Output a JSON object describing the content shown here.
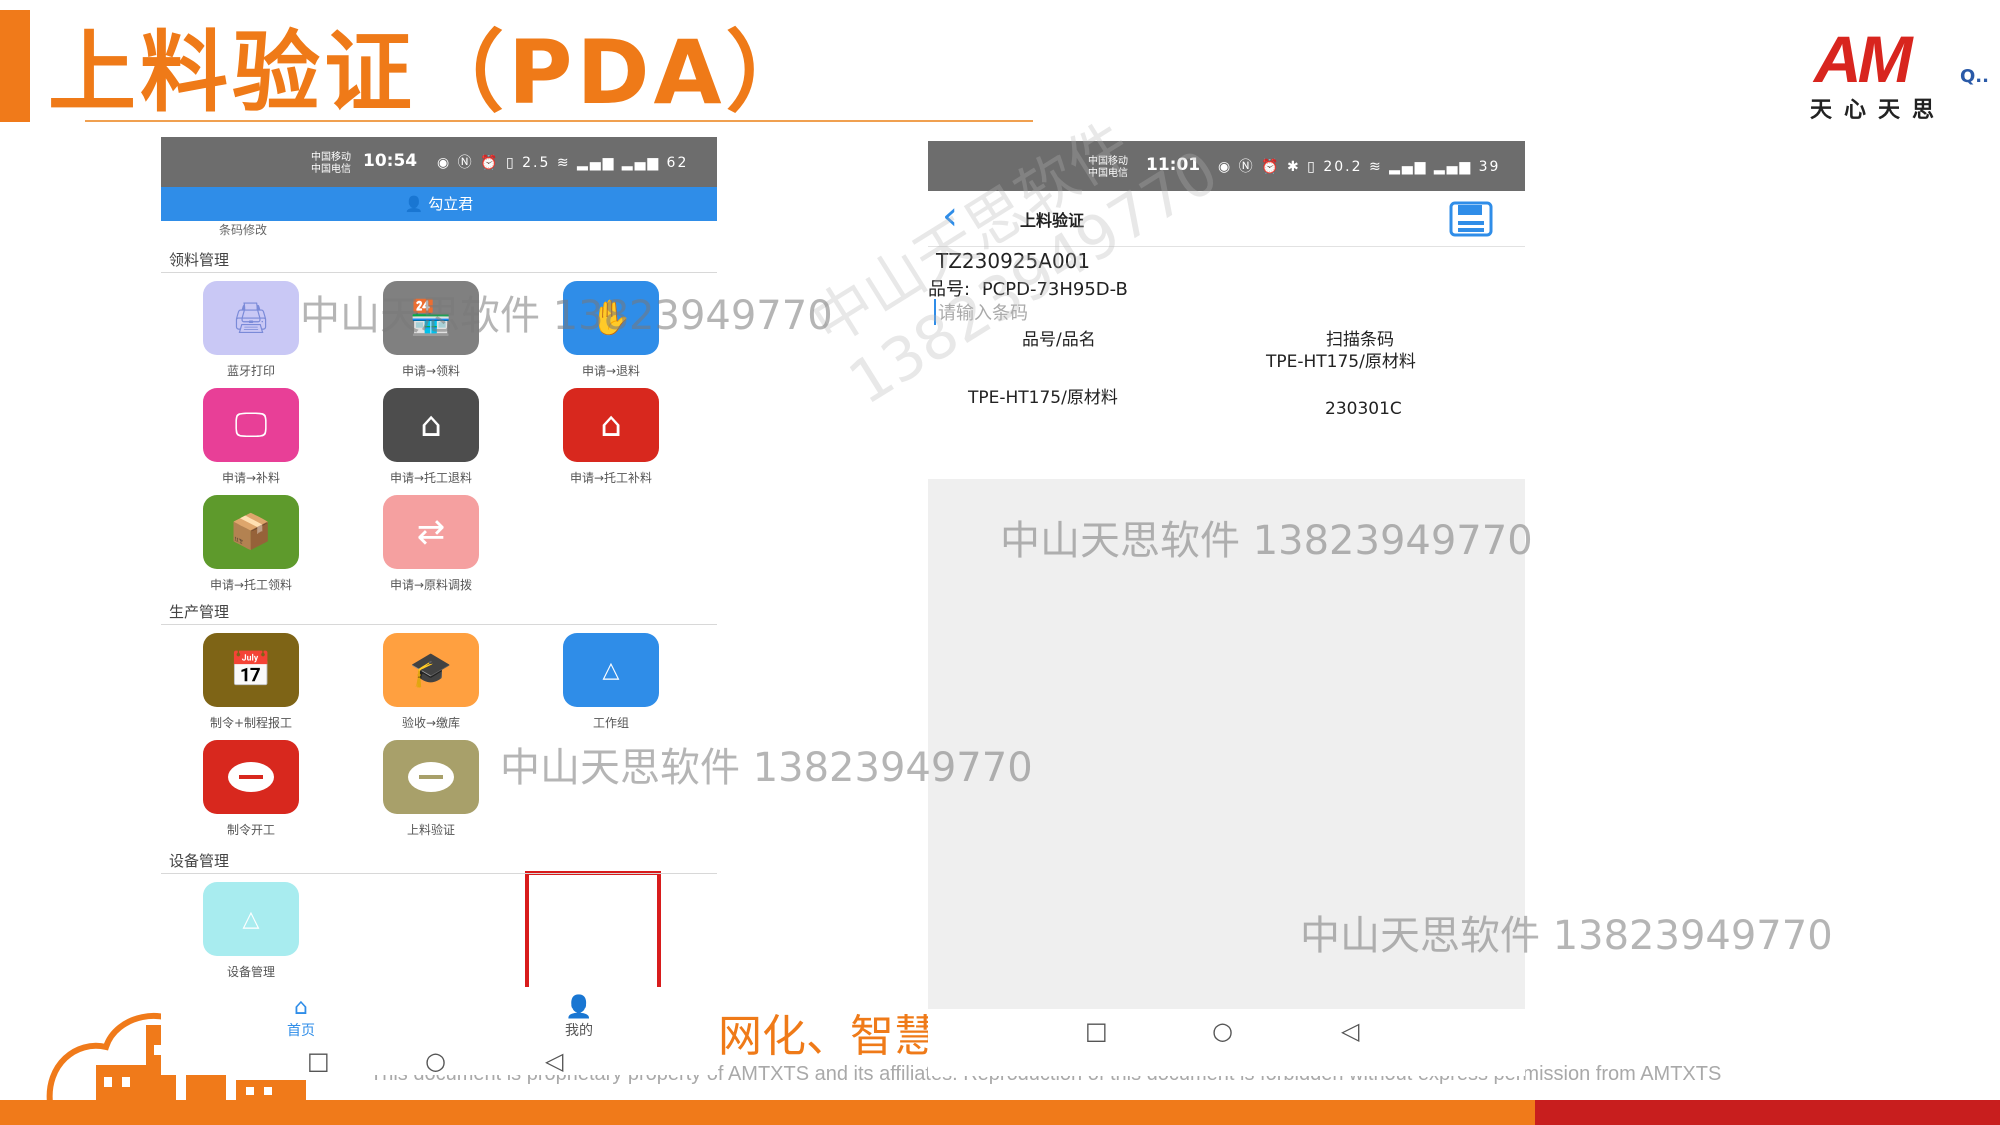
{
  "slide": {
    "title": "上料验证（PDA）",
    "logo_text": "AM",
    "logo_suffix": "Q..",
    "logo_subtitle": "天心天思",
    "slogan": "网化、智慧",
    "footer": "This document is proprietary property of AMTXTS and its affiliates. Reproduction of this document is forbidden without express permission from AMTXTS",
    "colors": {
      "accent": "#ef7a18",
      "red": "#c81e1e",
      "phone_blue": "#2f8de8"
    }
  },
  "watermarks": [
    "中山天思软件 13823949770",
    "中山天思软件 13823949770",
    "中山天思软件 13823949770",
    "中山天思软件 13823949770"
  ],
  "watermark_diagonal": [
    "中山天思软件",
    "13823949770"
  ],
  "phone1": {
    "status": {
      "carrier1": "中国移动",
      "carrier2": "中国电信",
      "time": "10:54",
      "icons": "◉ Ⓝ ⏰ ▯ 2.5 ≋ ▂▄▆ ▂▄▆ 62"
    },
    "user": "勾立君",
    "hint": "条码修改",
    "sections": {
      "material": "领料管理",
      "production": "生产管理",
      "equipment": "设备管理"
    },
    "tiles": [
      {
        "label": "蓝牙打印",
        "icon": "printer-icon",
        "color": "#c9c8f5"
      },
      {
        "label": "申请→领料",
        "icon": "store-icon",
        "color": "#808080"
      },
      {
        "label": "申请→退料",
        "icon": "hand-return-icon",
        "color": "#2f8de8"
      },
      {
        "label": "申请→补料",
        "icon": "monitor-icon",
        "color": "#e83f97"
      },
      {
        "label": "申请→托工退料",
        "icon": "house-icon",
        "color": "#4d4d4d"
      },
      {
        "label": "申请→托工补料",
        "icon": "house-supply-icon",
        "color": "#d8281e"
      },
      {
        "label": "申请→托工领料",
        "icon": "box-icon",
        "color": "#5e9a2c"
      },
      {
        "label": "申请→原料调拨",
        "icon": "transfer-icon",
        "color": "#f5a0a0"
      },
      {
        "label": "制令+制程报工",
        "icon": "calendar-icon",
        "color": "#7e6416"
      },
      {
        "label": "验收→缴库",
        "icon": "cap-icon",
        "color": "#ffa040"
      },
      {
        "label": "工作组",
        "icon": "triangle-icon",
        "color": "#2f8de8"
      },
      {
        "label": "制令开工",
        "icon": "minus-circle-icon",
        "color": "#d8281e"
      },
      {
        "label": "上料验证",
        "icon": "minus-circle-icon",
        "color": "#a8a06a"
      },
      {
        "label": "设备管理",
        "icon": "triangle-icon",
        "color": "#a8ecef"
      }
    ],
    "nav": {
      "home": "首页",
      "mine": "我的"
    },
    "sysnav": [
      "□",
      "○",
      "◁"
    ]
  },
  "phone2": {
    "status": {
      "carrier1": "中国移动",
      "carrier2": "中国电信",
      "time": "11:01",
      "icons": "◉ Ⓝ ⏰ ✱ ▯ 20.2 ≋ ▂▄▆ ▂▄▆ 39"
    },
    "title": "上料验证",
    "order": "TZ230925A001",
    "part_label": "品号:",
    "part_no": "PCPD-73H95D-B",
    "barcode_placeholder": "请输入条码",
    "col_part": "品号/品名",
    "col_scan": "扫描条码",
    "row": {
      "scan_top": "TPE-HT175/原材料",
      "part": "TPE-HT175/原材料",
      "barcode": "230301C"
    },
    "sysnav": [
      "□",
      "○",
      "◁"
    ]
  }
}
